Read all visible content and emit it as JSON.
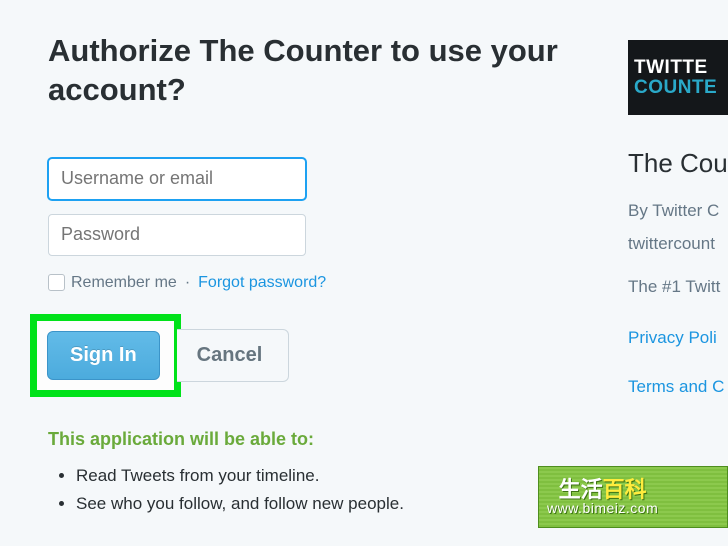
{
  "heading": "Authorize The Counter to use your account?",
  "form": {
    "username_placeholder": "Username or email",
    "password_placeholder": "Password",
    "remember_label": "Remember me",
    "forgot_label": "Forgot password?",
    "signin_label": "Sign In",
    "cancel_label": "Cancel"
  },
  "abilities": {
    "heading": "This application will be able to:",
    "items": [
      "Read Tweets from your timeline.",
      "See who you follow, and follow new people."
    ]
  },
  "side": {
    "logo_line1": "TWITTE",
    "logo_line2": "COUNTE",
    "app_name": "The Cou",
    "by_line": "By Twitter C",
    "domain": "twittercount",
    "desc": "The #1 Twitt",
    "privacy": "Privacy Poli",
    "terms": "Terms and C"
  },
  "watermark": {
    "cn1": "生活",
    "cn2": "百科",
    "url": "www.bimeiz.com"
  }
}
